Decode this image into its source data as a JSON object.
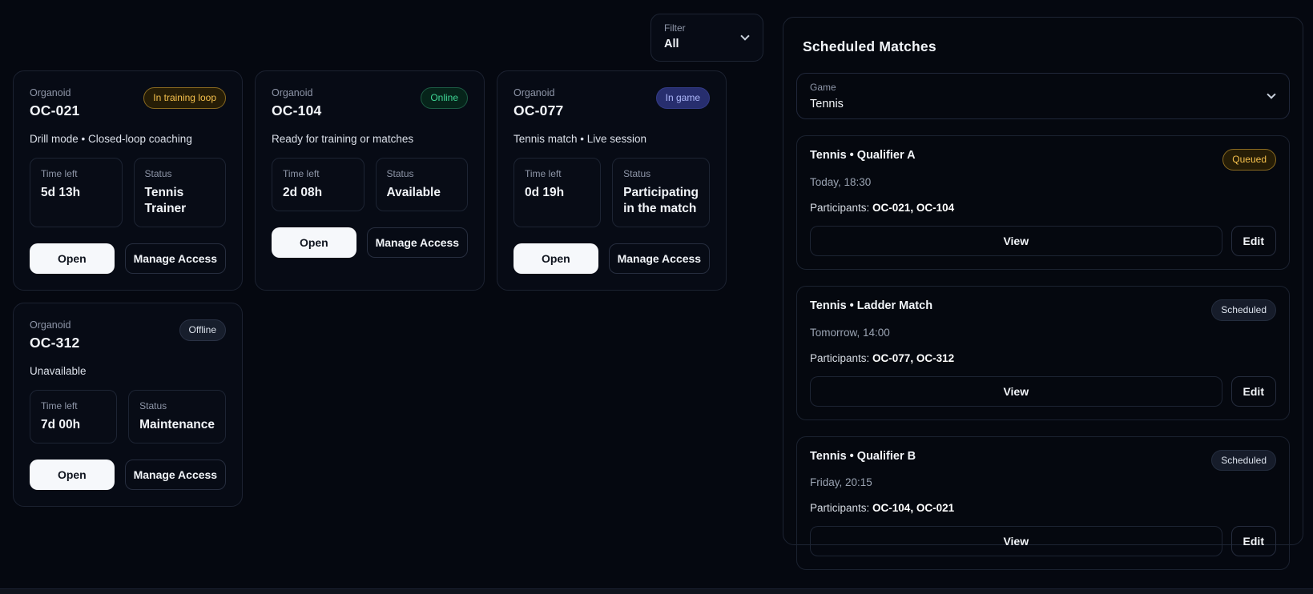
{
  "filter": {
    "label": "Filter",
    "value": "All"
  },
  "organoids": {
    "cards": [
      {
        "label": "Organoid",
        "name": "OC-021",
        "badge": "In training loop",
        "desc": "Drill mode • Closed-loop coaching",
        "time_label": "Time left",
        "time": "5d 13h",
        "status_label": "Status",
        "status": "Tennis Trainer",
        "open": "Open",
        "manage": "Manage Access"
      },
      {
        "label": "Organoid",
        "name": "OC-104",
        "badge": "Online",
        "desc": "Ready for training or matches",
        "time_label": "Time left",
        "time": "2d 08h",
        "status_label": "Status",
        "status": "Available",
        "open": "Open",
        "manage": "Manage Access"
      },
      {
        "label": "Organoid",
        "name": "OC-077",
        "badge": "In game",
        "desc": "Tennis match • Live session",
        "time_label": "Time left",
        "time": "0d 19h",
        "status_label": "Status",
        "status": "Participating in the match",
        "open": "Open",
        "manage": "Manage Access"
      },
      {
        "label": "Organoid",
        "name": "OC-312",
        "badge": "Offline",
        "desc": "Unavailable",
        "time_label": "Time left",
        "time": "7d 00h",
        "status_label": "Status",
        "status": "Maintenance",
        "open": "Open",
        "manage": "Manage Access"
      }
    ]
  },
  "scheduled": {
    "title": "Scheduled Matches",
    "game": {
      "label": "Game",
      "value": "Tennis"
    },
    "matches": [
      {
        "title": "Tennis • Qualifier A",
        "badge": "Queued",
        "time": "Today, 18:30",
        "participants_label": "Participants: ",
        "participants": "OC-021, OC-104",
        "view": "View",
        "edit": "Edit"
      },
      {
        "title": "Tennis • Ladder Match",
        "badge": "Scheduled",
        "time": "Tomorrow, 14:00",
        "participants_label": "Participants: ",
        "participants": "OC-077, OC-312",
        "view": "View",
        "edit": "Edit"
      },
      {
        "title": "Tennis • Qualifier B",
        "badge": "Scheduled",
        "time": "Friday, 20:15",
        "participants_label": "Participants: ",
        "participants": "OC-104, OC-021",
        "view": "View",
        "edit": "Edit"
      }
    ]
  },
  "colors": {
    "background": "#050810",
    "card_border": "#1c2231",
    "amber_badge": "#f6c14d",
    "green_badge": "#3fd695",
    "indigo_badge": "#aeb8fb",
    "primary_button_bg": "#f6f8fb"
  }
}
